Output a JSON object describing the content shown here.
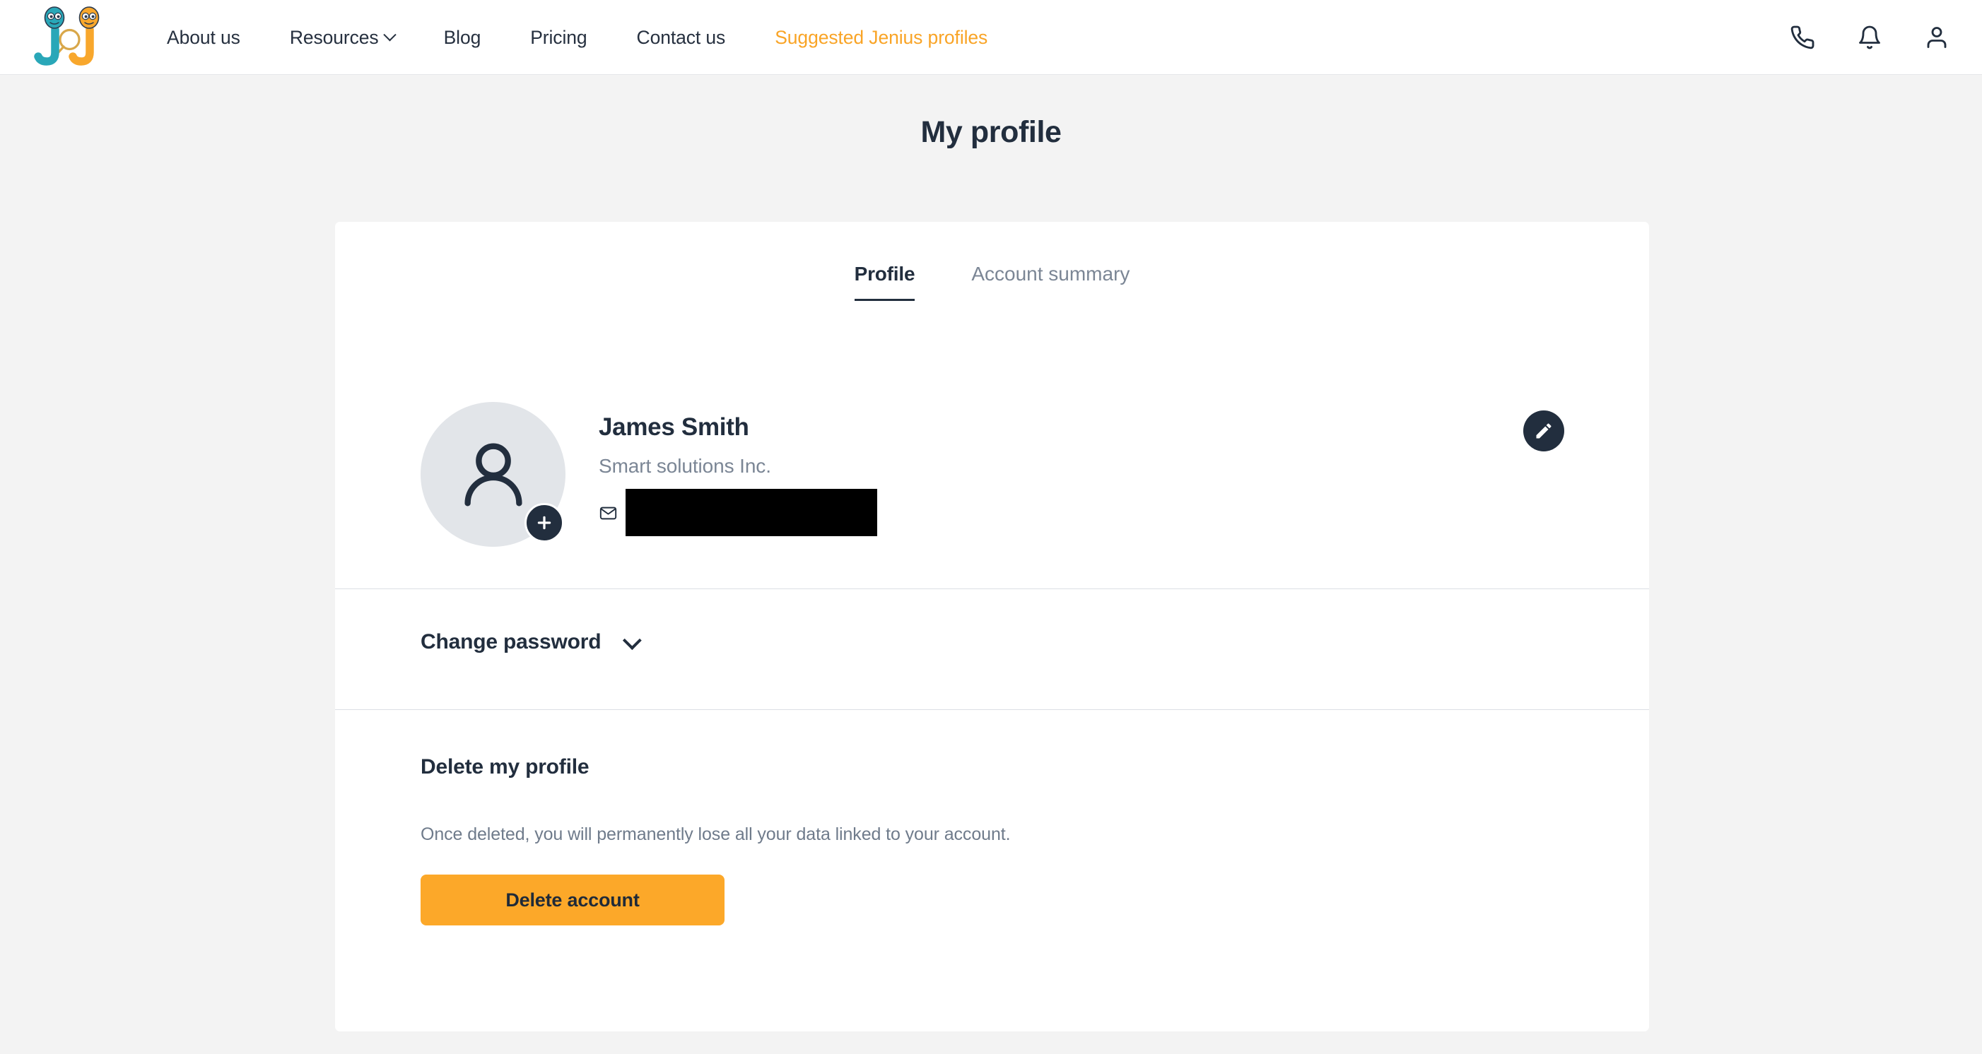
{
  "navbar": {
    "logo_alt": "jj-logo",
    "links": [
      {
        "label": "About us",
        "has_chevron": false,
        "highlight": false
      },
      {
        "label": "Resources",
        "has_chevron": true,
        "highlight": false
      },
      {
        "label": "Blog",
        "has_chevron": false,
        "highlight": false
      },
      {
        "label": "Pricing",
        "has_chevron": false,
        "highlight": false
      },
      {
        "label": "Contact us",
        "has_chevron": false,
        "highlight": false
      },
      {
        "label": "Suggested Jenius profiles",
        "has_chevron": false,
        "highlight": true
      }
    ],
    "icons": [
      "phone-icon",
      "bell-icon",
      "user-icon"
    ]
  },
  "page": {
    "title": "My profile"
  },
  "tabs": [
    {
      "label": "Profile",
      "active": true
    },
    {
      "label": "Account summary",
      "active": false
    }
  ],
  "profile": {
    "avatar_icon": "person-icon",
    "avatar_add_icon": "plus-icon",
    "name": "James Smith",
    "company": "Smart solutions Inc.",
    "email_icon": "envelope-icon",
    "email_value": "",
    "email_redacted": true,
    "edit_icon": "pencil-icon"
  },
  "password_section": {
    "title": "Change password",
    "expanded": false,
    "chevron_icon": "chevron-down-icon"
  },
  "delete_section": {
    "title": "Delete my profile",
    "description": "Once deleted, you will permanently lose all your data linked to your account.",
    "button_label": "Delete account"
  },
  "colors": {
    "page_background": "#f3f3f3",
    "card_background": "#ffffff",
    "navy": "#222e3e",
    "muted_text": "#7b8695",
    "accent_orange": "#fca829",
    "highlight_link": "#f9a426",
    "divider": "#dcdfe4",
    "avatar_background": "#e2e5e9",
    "logo_teal": "#29a7b8",
    "logo_orange": "#f8a72c"
  }
}
